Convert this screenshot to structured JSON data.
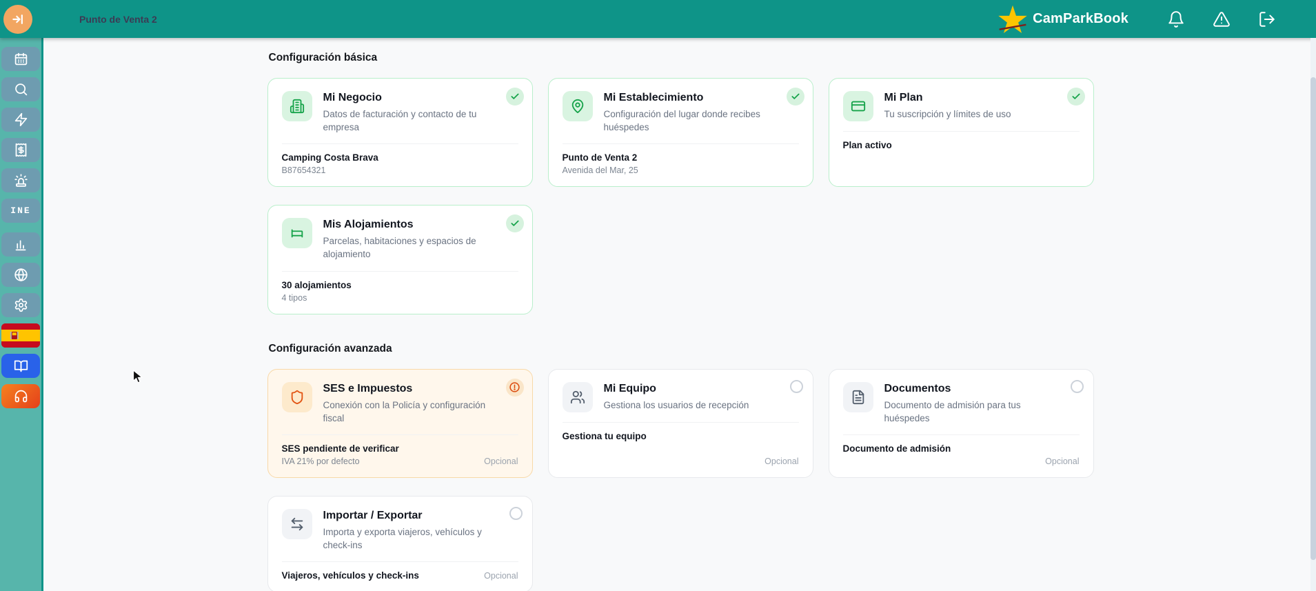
{
  "header": {
    "workspace": "Punto de Venta 2",
    "brand": "CamParkBook",
    "actions": [
      "notifications",
      "alerts",
      "logout"
    ]
  },
  "sidebar": {
    "ine_label": "INE",
    "items": [
      "calendar",
      "search",
      "quick-actions",
      "receipts",
      "alarms",
      "ine",
      "stats",
      "web",
      "settings",
      "language-spanish",
      "guide",
      "support"
    ]
  },
  "sections": [
    {
      "title": "Configuración básica",
      "cards": [
        {
          "title": "Mi Negocio",
          "description": "Datos de facturación y contacto de tu empresa",
          "status": "complete",
          "footer_primary": "Camping Costa Brava",
          "footer_secondary": "B87654321",
          "icon": "building-icon"
        },
        {
          "title": "Mi Establecimiento",
          "description": "Configuración del lugar donde recibes huéspedes",
          "status": "complete",
          "footer_primary": "Punto de Venta 2",
          "footer_secondary": "Avenida del Mar, 25",
          "icon": "map-pin-icon"
        },
        {
          "title": "Mi Plan",
          "description": "Tu suscripción y límites de uso",
          "status": "complete",
          "footer_primary": "Plan activo",
          "icon": "credit-card-icon"
        },
        {
          "title": "Mis Alojamientos",
          "description": "Parcelas, habitaciones y espacios de alojamiento",
          "status": "complete",
          "footer_primary": "30 alojamientos",
          "footer_secondary": "4 tipos",
          "icon": "bed-icon"
        }
      ]
    },
    {
      "title": "Configuración avanzada",
      "cards": [
        {
          "title": "SES e Impuestos",
          "description": "Conexión con la Policía y configuración fiscal",
          "status": "warning",
          "footer_primary": "SES pendiente de verificar",
          "footer_secondary": "IVA 21% por defecto",
          "tag": "Opcional",
          "icon": "shield-icon"
        },
        {
          "title": "Mi Equipo",
          "description": "Gestiona los usuarios de recepción",
          "status": "pending",
          "footer_primary": "Gestiona tu equipo",
          "tag": "Opcional",
          "icon": "users-icon"
        },
        {
          "title": "Documentos",
          "description": "Documento de admisión para tus huéspedes",
          "status": "pending",
          "footer_primary": "Documento de admisión",
          "tag": "Opcional",
          "icon": "document-icon"
        },
        {
          "title": "Importar / Exportar",
          "description": "Importa y exporta viajeros, vehículos y check-ins",
          "status": "pending",
          "footer_primary": "Viajeros, vehículos y check-ins",
          "tag": "Opcional",
          "icon": "import-export-icon"
        }
      ]
    }
  ],
  "colors": {
    "header_teal": "#0e9488",
    "sidebar_teal": "#57b5ab",
    "sidebar_button": "#6e9cb0",
    "toggle_orange": "#f2a661",
    "star_gold": "#fdc500",
    "brand_white": "#ffffff",
    "green_accent": "#16a34a",
    "green_border": "#b9efcb",
    "orange_accent": "#e25412",
    "orange_card_bg": "#fff7ec",
    "orange_border": "#f8d9a8",
    "book_blue": "#2962e9",
    "support_orange": "#f5821f",
    "flag_red": "#c60b1e",
    "flag_yellow": "#ffc400",
    "text_dark": "#12161f",
    "text_muted": "#6a7382",
    "optional_gray": "#9ba3ae",
    "page_bg": "#f8f9fa"
  }
}
